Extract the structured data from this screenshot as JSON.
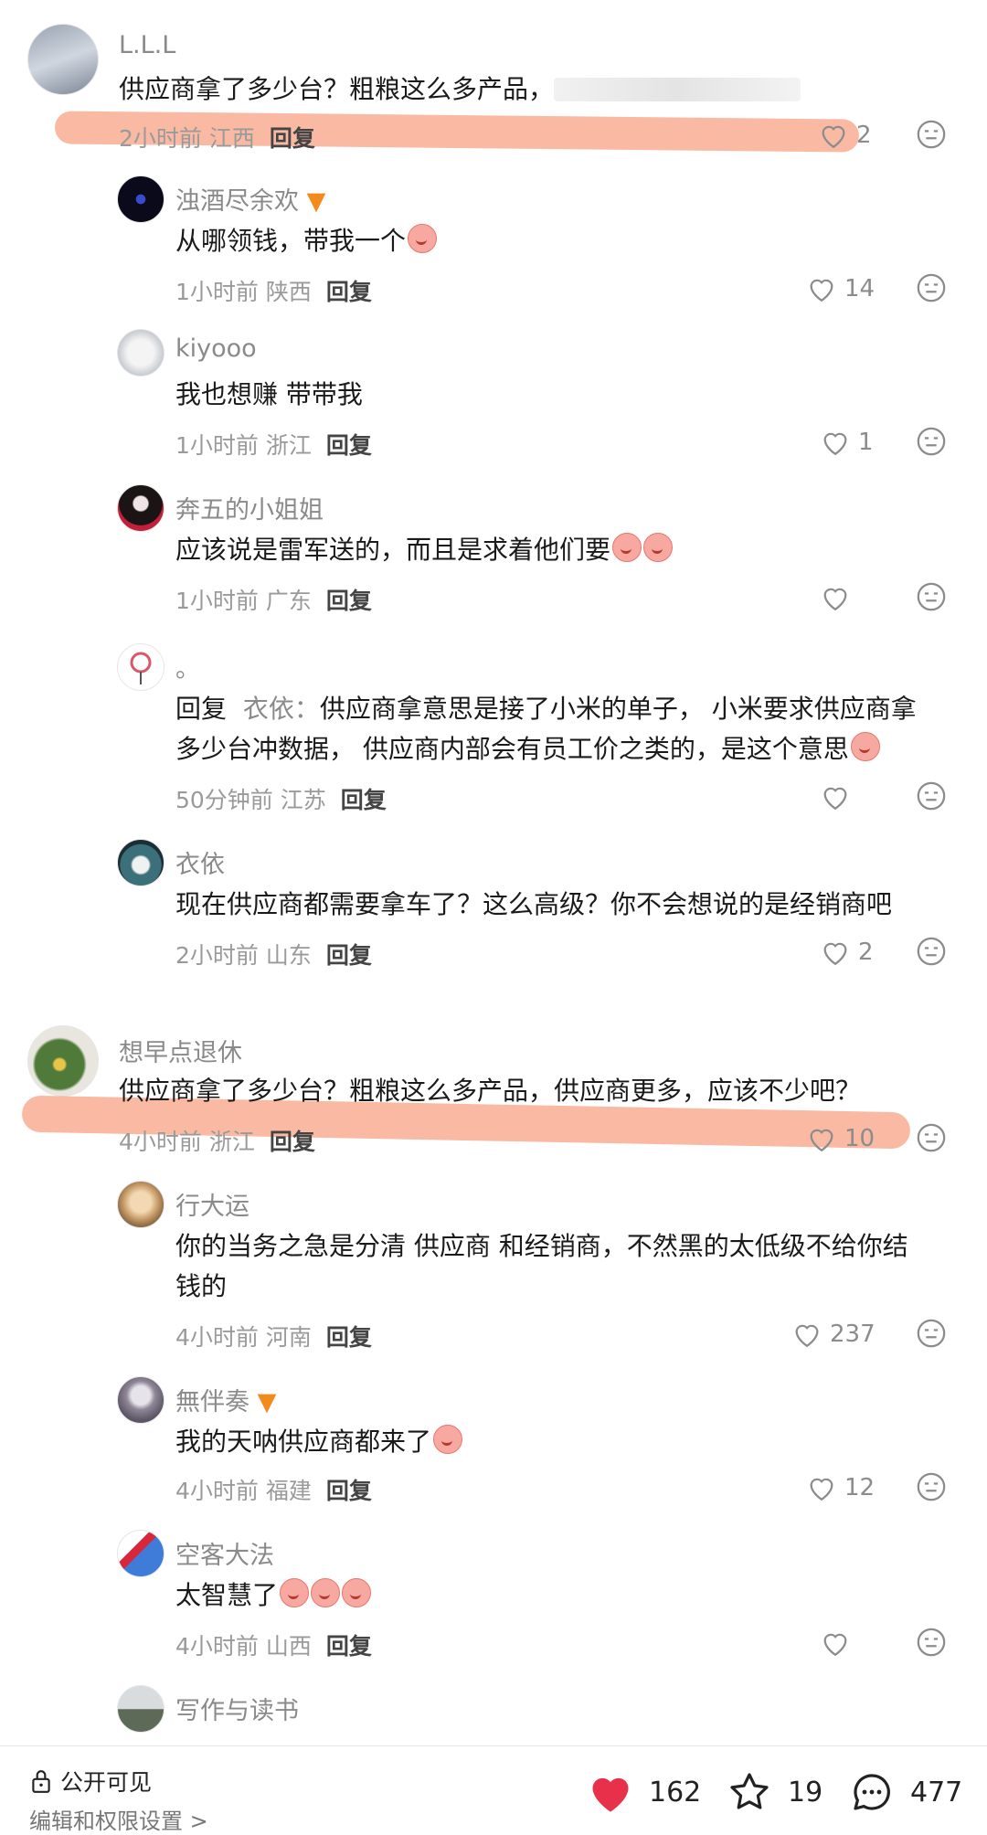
{
  "reply_label": "回复",
  "comments": [
    {
      "username": "L.L.L",
      "text": "供应商拿了多少台？粗粮这么多产品，",
      "time": "2小时前",
      "location": "江西",
      "likes": "2"
    },
    {
      "username": "浊酒尽余欢",
      "text": "从哪领钱，带我一个",
      "time": "1小时前",
      "location": "陕西",
      "likes": "14"
    },
    {
      "username": "kiyooo",
      "text": "我也想赚 带带我",
      "time": "1小时前",
      "location": "浙江",
      "likes": "1"
    },
    {
      "username": "奔五的小姐姐",
      "text": "应该说是雷军送的，而且是求着他们要",
      "time": "1小时前",
      "location": "广东",
      "likes": ""
    },
    {
      "username": "。",
      "reply_to": "衣依：",
      "text_line1": "供应商拿意思是接了小米的单子， 小米要求供应商拿",
      "text_line2": "多少台冲数据， 供应商内部会有员工价之类的，是这个意思",
      "time": "50分钟前",
      "location": "江苏",
      "likes": ""
    },
    {
      "username": "衣依",
      "text": "现在供应商都需要拿车了？这么高级？你不会想说的是经销商吧",
      "time": "2小时前",
      "location": "山东",
      "likes": "2"
    },
    {
      "username": "想早点退休",
      "text": "供应商拿了多少台？粗粮这么多产品，供应商更多，应该不少吧？",
      "time": "4小时前",
      "location": "浙江",
      "likes": "10"
    },
    {
      "username": "行大运",
      "text_line1": "你的当务之急是分清 供应商 和经销商，不然黑的太低级不给你结",
      "text_line2": "钱的",
      "time": "4小时前",
      "location": "河南",
      "likes": "237"
    },
    {
      "username": "無伴奏",
      "text": "我的天呐供应商都来了",
      "time": "4小时前",
      "location": "福建",
      "likes": "12"
    },
    {
      "username": "空客大法",
      "text": "太智慧了",
      "time": "4小时前",
      "location": "山西",
      "likes": ""
    },
    {
      "username": "写作与读书"
    }
  ],
  "bottom": {
    "visibility": "公开可见",
    "settings": "编辑和权限设置 >",
    "likes": "162",
    "favorites": "19",
    "comments": "477"
  },
  "colors": {
    "highlight": "#f7a184",
    "like_red": "#e8304a"
  }
}
